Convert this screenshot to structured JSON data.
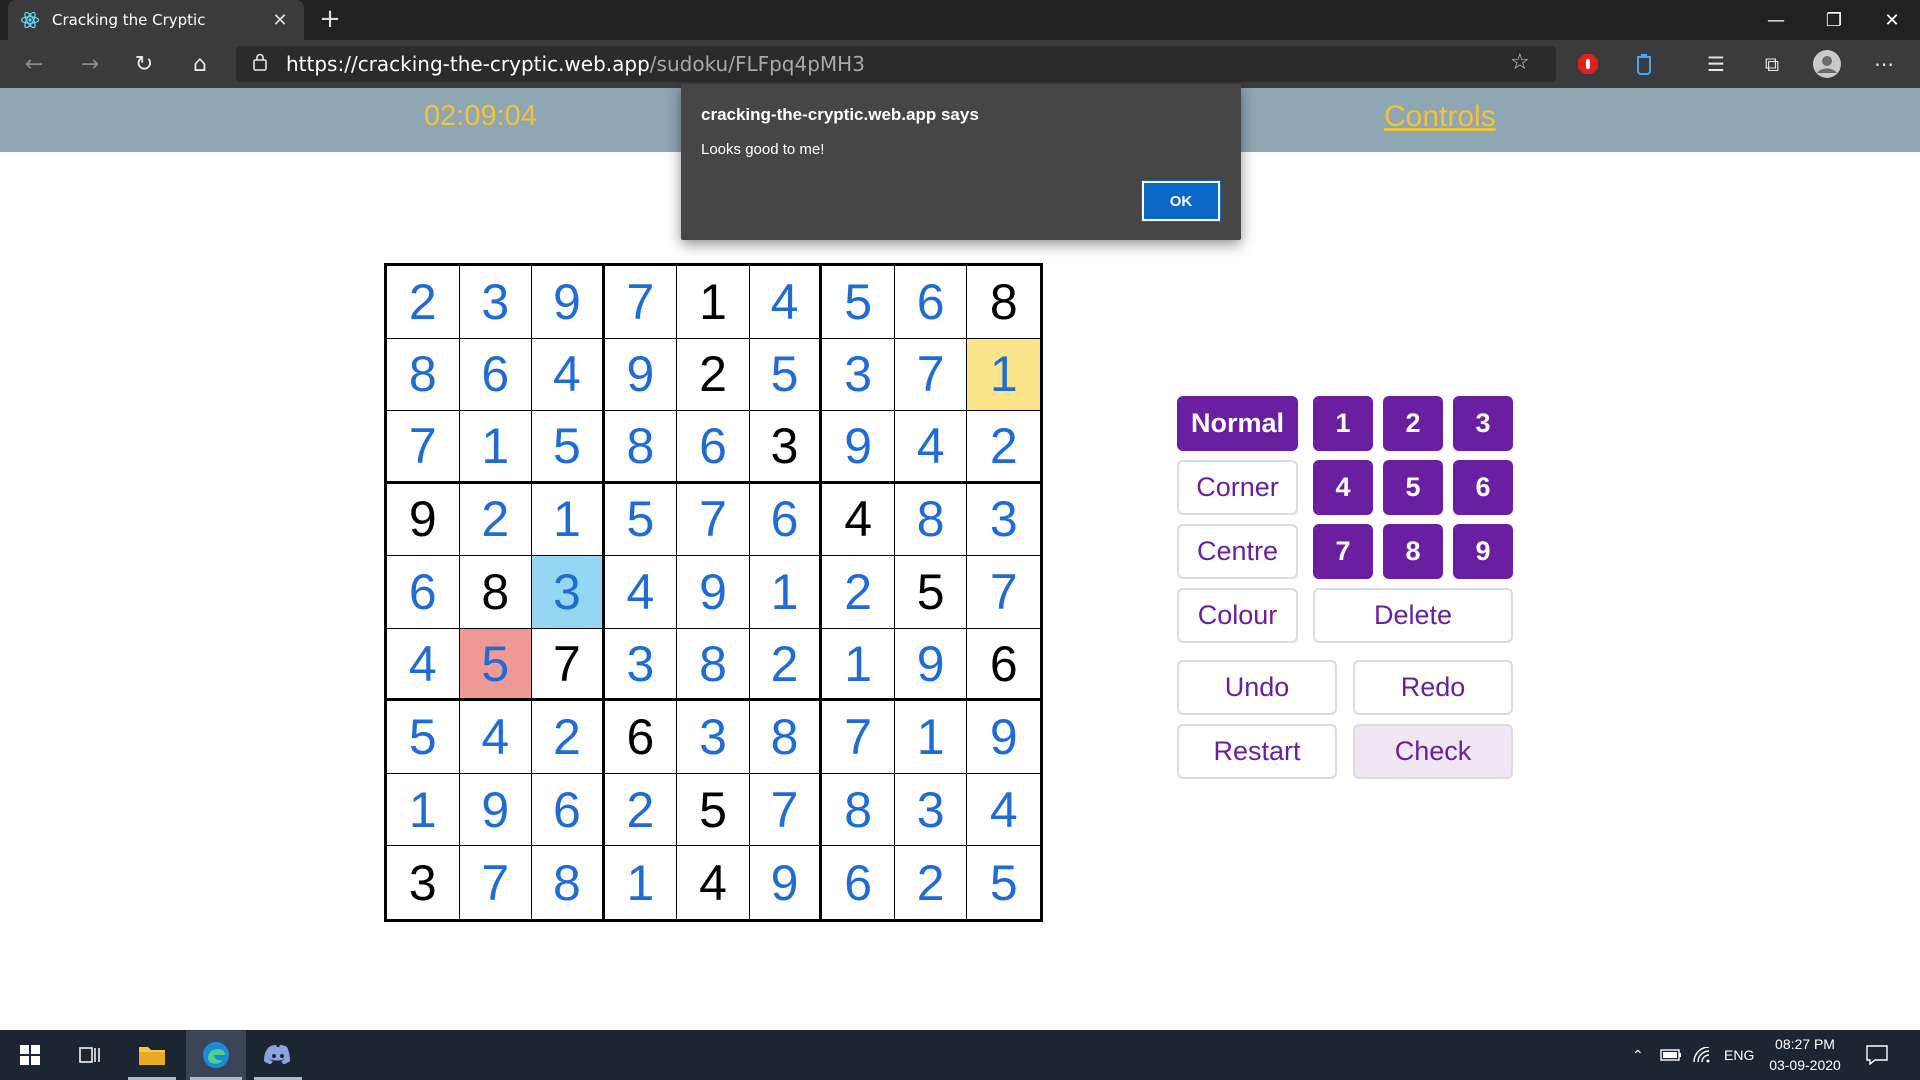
{
  "browser": {
    "tab_title": "Cracking the Cryptic",
    "url_host": "https://cracking-the-cryptic.web.app",
    "url_path": "/sudoku/FLFpq4pMH3"
  },
  "app": {
    "timer": "02:09:04",
    "controls_label": "Controls"
  },
  "dialog": {
    "title": "cracking-the-cryptic.web.app says",
    "message": "Looks good to me!",
    "ok_label": "OK"
  },
  "sudoku": {
    "digits": [
      [
        2,
        3,
        9,
        7,
        1,
        4,
        5,
        6,
        8
      ],
      [
        8,
        6,
        4,
        9,
        2,
        5,
        3,
        7,
        1
      ],
      [
        7,
        1,
        5,
        8,
        6,
        3,
        9,
        4,
        2
      ],
      [
        9,
        2,
        1,
        5,
        7,
        6,
        4,
        8,
        3
      ],
      [
        6,
        8,
        3,
        4,
        9,
        1,
        2,
        5,
        7
      ],
      [
        4,
        5,
        7,
        3,
        8,
        2,
        1,
        9,
        6
      ],
      [
        5,
        4,
        2,
        6,
        3,
        8,
        7,
        1,
        9
      ],
      [
        1,
        9,
        6,
        2,
        5,
        7,
        8,
        3,
        4
      ],
      [
        3,
        7,
        8,
        1,
        4,
        9,
        6,
        2,
        5
      ]
    ],
    "givens": [
      [
        0,
        4
      ],
      [
        0,
        8
      ],
      [
        1,
        4
      ],
      [
        2,
        5
      ],
      [
        3,
        0
      ],
      [
        3,
        6
      ],
      [
        4,
        1
      ],
      [
        4,
        7
      ],
      [
        5,
        2
      ],
      [
        5,
        8
      ],
      [
        6,
        3
      ],
      [
        7,
        4
      ],
      [
        8,
        0
      ],
      [
        8,
        4
      ]
    ],
    "colored_cells": [
      {
        "row": 1,
        "col": 8,
        "color": "#fbe38a"
      },
      {
        "row": 4,
        "col": 2,
        "color": "#93d7f2"
      },
      {
        "row": 5,
        "col": 1,
        "color": "#f09a97"
      }
    ],
    "given_color": "#000000",
    "entered_color": "#1f6dd4"
  },
  "controls": {
    "modes": [
      "Normal",
      "Corner",
      "Centre",
      "Colour"
    ],
    "active_mode": "Normal",
    "numbers": [
      "1",
      "2",
      "3",
      "4",
      "5",
      "6",
      "7",
      "8",
      "9"
    ],
    "delete_label": "Delete",
    "undo_label": "Undo",
    "redo_label": "Redo",
    "restart_label": "Restart",
    "check_label": "Check",
    "accent_color": "#6a1fa0"
  },
  "taskbar": {
    "language": "ENG",
    "time": "08:27 PM",
    "date": "03-09-2020"
  }
}
